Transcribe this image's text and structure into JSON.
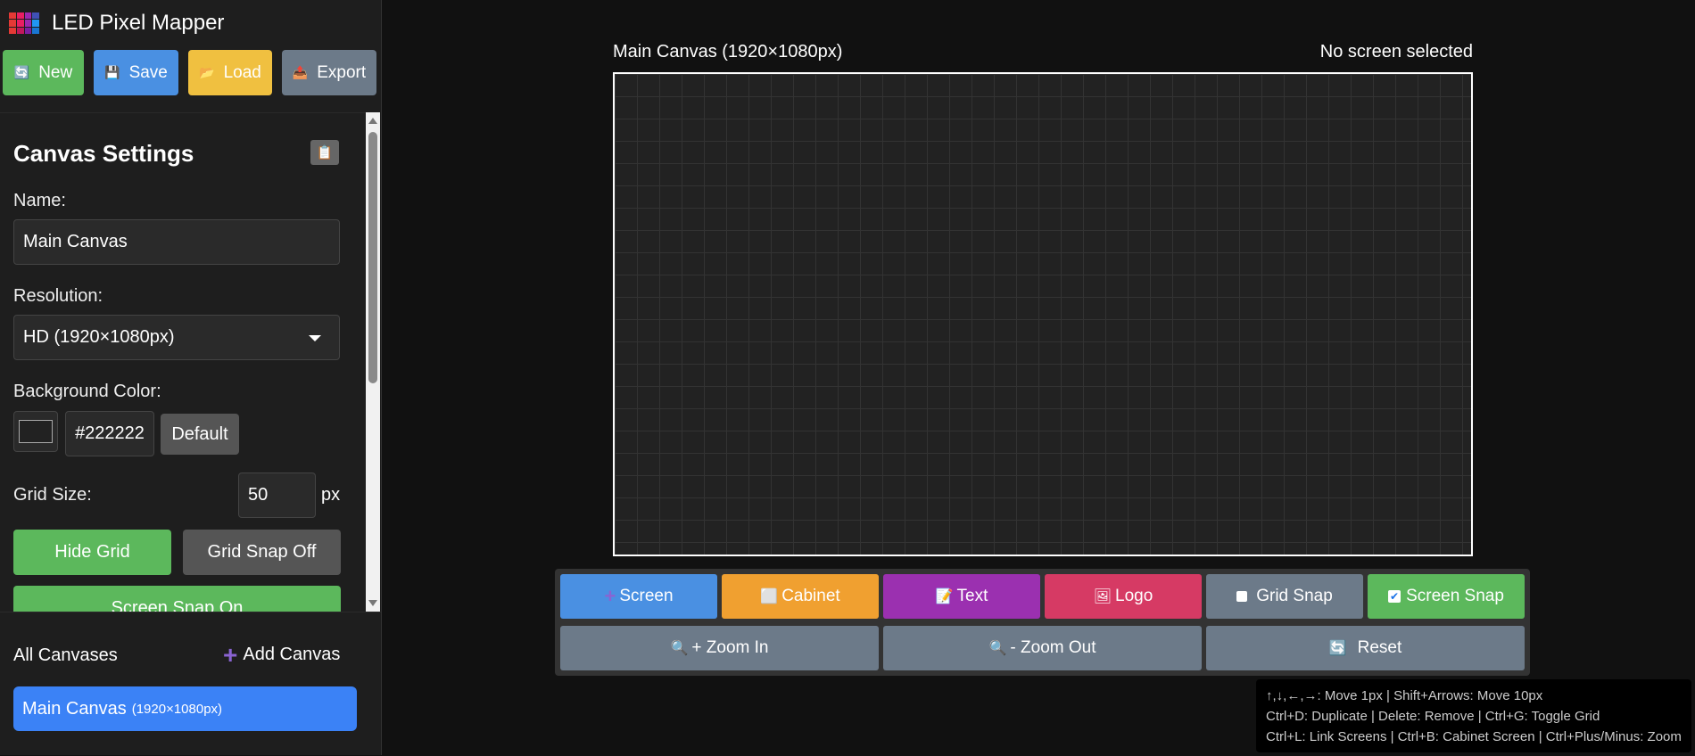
{
  "app": {
    "title": "LED Pixel Mapper"
  },
  "top_buttons": [
    {
      "label": "New",
      "icon": "refresh-icon",
      "color": "#5cb85c"
    },
    {
      "label": "Save",
      "icon": "floppy-icon",
      "color": "#4a90e2"
    },
    {
      "label": "Load",
      "icon": "folder-icon",
      "color": "#f0c040"
    },
    {
      "label": "Export",
      "icon": "export-icon",
      "color": "#6c7a89"
    }
  ],
  "settings": {
    "title": "Canvas Settings",
    "name_label": "Name:",
    "name_value": "Main Canvas",
    "resolution_label": "Resolution:",
    "resolution_value": "HD (1920×1080px)",
    "bg_label": "Background Color:",
    "bg_color": "#222222",
    "bg_hex": "#222222",
    "default_label": "Default",
    "grid_size_label": "Grid Size:",
    "grid_size_value": "50",
    "grid_unit": "px",
    "hide_grid_label": "Hide Grid",
    "grid_snap_label": "Grid Snap Off",
    "screen_snap_label": "Screen Snap On"
  },
  "canvases": {
    "heading": "All Canvases",
    "add_label": "Add Canvas",
    "items": [
      {
        "name": "Main Canvas",
        "res": "(1920×1080px)"
      }
    ]
  },
  "main": {
    "canvas_title": "Main Canvas (1920×1080px)",
    "screen_status": "No screen selected"
  },
  "toolbar": {
    "screen": "Screen",
    "cabinet": "Cabinet",
    "text": "Text",
    "logo": "Logo",
    "grid_snap": "Grid Snap",
    "screen_snap": "Screen Snap",
    "zoom_in": "+ Zoom In",
    "zoom_out": "- Zoom Out",
    "reset": "Reset"
  },
  "help": {
    "line1": "↑,↓,←,→: Move 1px | Shift+Arrows: Move 10px",
    "line2": "Ctrl+D: Duplicate | Delete: Remove | Ctrl+G: Toggle Grid",
    "line3": "Ctrl+L: Link Screens | Ctrl+B: Cabinet Screen | Ctrl+Plus/Minus: Zoom"
  }
}
